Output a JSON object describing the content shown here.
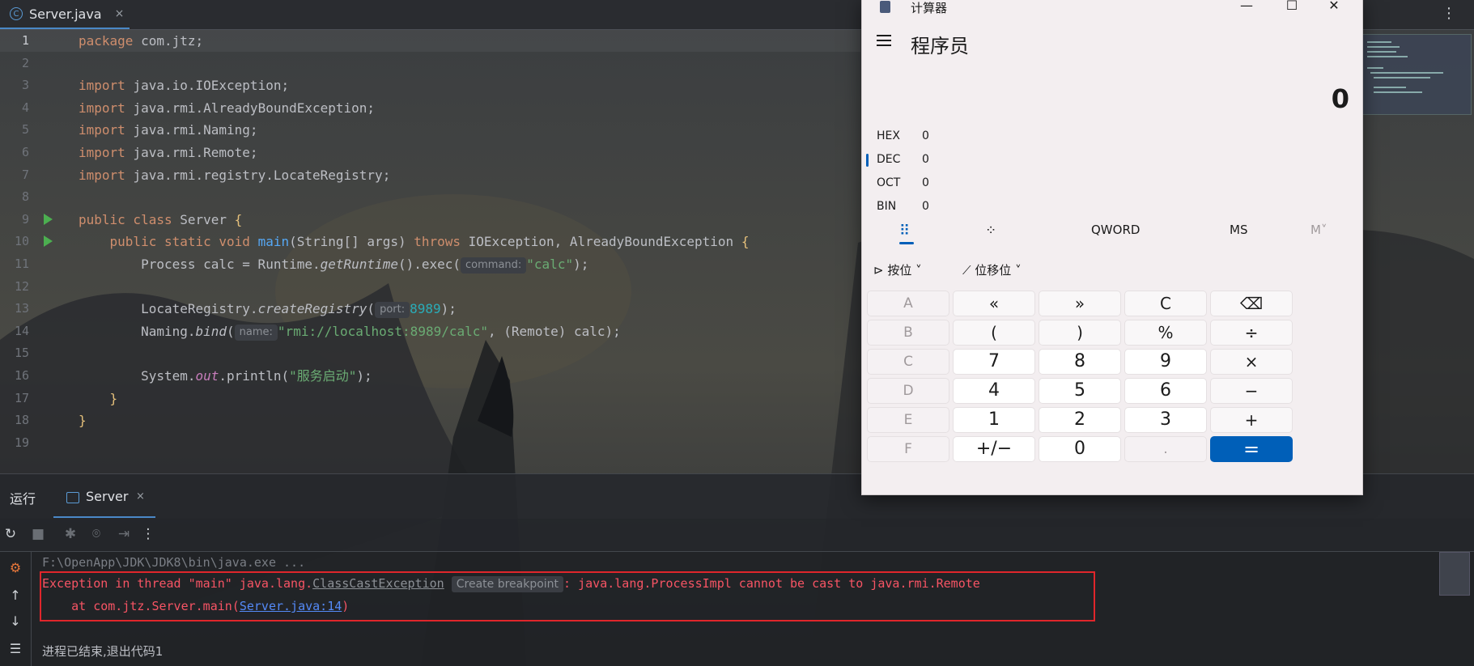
{
  "editor": {
    "tab_label": "Server.java",
    "tab_close": "×",
    "menu": "⋮",
    "lines": [
      {
        "n": "1",
        "current": true,
        "run": false,
        "tokens": [
          [
            "kw",
            "package "
          ],
          [
            "",
            "com.jtz;"
          ]
        ]
      },
      {
        "n": "2",
        "tokens": []
      },
      {
        "n": "3",
        "tokens": [
          [
            "kw",
            "import "
          ],
          [
            "",
            "java.io.IOException;"
          ]
        ]
      },
      {
        "n": "4",
        "tokens": [
          [
            "kw",
            "import "
          ],
          [
            "",
            "java.rmi.AlreadyBoundException;"
          ]
        ]
      },
      {
        "n": "5",
        "tokens": [
          [
            "kw",
            "import "
          ],
          [
            "",
            "java.rmi.Naming;"
          ]
        ]
      },
      {
        "n": "6",
        "tokens": [
          [
            "kw",
            "import "
          ],
          [
            "",
            "java.rmi.Remote;"
          ]
        ]
      },
      {
        "n": "7",
        "tokens": [
          [
            "kw",
            "import "
          ],
          [
            "",
            "java.rmi.registry.LocateRegistry;"
          ]
        ]
      },
      {
        "n": "8",
        "tokens": []
      },
      {
        "n": "9",
        "run": true,
        "tokens": [
          [
            "kw",
            "public class "
          ],
          [
            "",
            "Server "
          ],
          [
            "br1",
            "{"
          ]
        ]
      },
      {
        "n": "10",
        "run": true,
        "tokens": [
          [
            "",
            "    "
          ],
          [
            "kw",
            "public static void "
          ],
          [
            "fn",
            "main"
          ],
          [
            "",
            "(String[] args) "
          ],
          [
            "kw",
            "throws "
          ],
          [
            "",
            "IOException, AlreadyBoundException "
          ],
          [
            "br1",
            "{"
          ]
        ]
      },
      {
        "n": "11",
        "tokens": [
          [
            "",
            "        Process calc = Runtime."
          ],
          [
            "it",
            "getRuntime"
          ],
          [
            "",
            "().exec("
          ],
          [
            "hint",
            "command:"
          ],
          [
            "str",
            "\"calc\""
          ],
          [
            "",
            ");"
          ]
        ]
      },
      {
        "n": "12",
        "tokens": []
      },
      {
        "n": "13",
        "tokens": [
          [
            "",
            "        LocateRegistry."
          ],
          [
            "it",
            "createRegistry"
          ],
          [
            "",
            "("
          ],
          [
            "hint",
            "port:"
          ],
          [
            "num",
            "8989"
          ],
          [
            "",
            ");"
          ]
        ]
      },
      {
        "n": "14",
        "tokens": [
          [
            "",
            "        Naming."
          ],
          [
            "it",
            "bind"
          ],
          [
            "",
            "("
          ],
          [
            "hint",
            "name:"
          ],
          [
            "str",
            "\"rmi://localhost:8989/calc\""
          ],
          [
            "",
            ", (Remote) calc);"
          ]
        ]
      },
      {
        "n": "15",
        "tokens": []
      },
      {
        "n": "16",
        "tokens": [
          [
            "",
            "        System."
          ],
          [
            "st",
            "out"
          ],
          [
            "",
            ".println("
          ],
          [
            "str",
            "\"服务启动\""
          ],
          [
            "",
            ");"
          ]
        ]
      },
      {
        "n": "17",
        "tokens": [
          [
            "",
            "    "
          ],
          [
            "br1",
            "}"
          ]
        ]
      },
      {
        "n": "18",
        "tokens": [
          [
            "br1",
            "}"
          ]
        ]
      },
      {
        "n": "19",
        "tokens": []
      }
    ]
  },
  "run_panel": {
    "title": "运行",
    "tab_label": "Server",
    "tab_close": "×",
    "tools": [
      "↻",
      "■",
      "✱",
      "⌾",
      "⇥",
      "⋮"
    ],
    "side": [
      "⚙",
      "↑",
      "↓",
      "☰"
    ],
    "cmd_line": "F:\\OpenApp\\JDK\\JDK8\\bin\\java.exe ...",
    "error_prefix": "Exception in thread \"main\" java.lang.",
    "error_class": "ClassCastException",
    "error_hint": "Create breakpoint",
    "error_suffix": ": java.lang.ProcessImpl cannot be cast to java.rmi.Remote",
    "stack_prefix": "    at com.jtz.Server.main(",
    "stack_link": "Server.java:14",
    "stack_suffix": ")",
    "exit_line": "进程已结束,退出代码1"
  },
  "calculator": {
    "title": "计算器",
    "window_buttons": {
      "minimize": "—",
      "maximize": "☐",
      "close": "✕"
    },
    "mode": "程序员",
    "display": "0",
    "radix": [
      {
        "label": "HEX",
        "value": "0"
      },
      {
        "label": "DEC",
        "value": "0"
      },
      {
        "label": "OCT",
        "value": "0"
      },
      {
        "label": "BIN",
        "value": "0"
      }
    ],
    "word_size": "QWORD",
    "memory_store": "MS",
    "memory_menu": "M˅",
    "bitwise_menu": "按位",
    "bitshift_menu": "位移位",
    "keys": [
      [
        "A",
        "«",
        "»",
        "C",
        "⌫"
      ],
      [
        "B",
        "(",
        ")",
        "%",
        "÷"
      ],
      [
        "C",
        "7",
        "8",
        "9",
        "×"
      ],
      [
        "D",
        "4",
        "5",
        "6",
        "−"
      ],
      [
        "E",
        "1",
        "2",
        "3",
        "+"
      ],
      [
        "F",
        "+/−",
        "0",
        ".",
        "="
      ]
    ]
  }
}
